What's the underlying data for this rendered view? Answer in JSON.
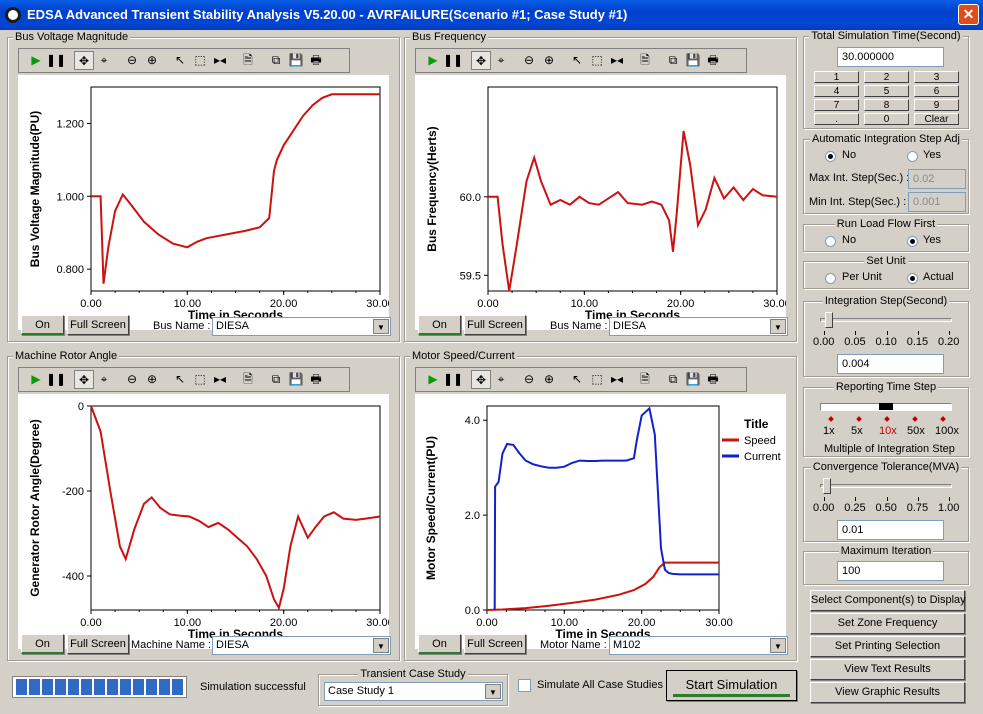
{
  "window": {
    "title": "EDSA Advanced Transient Stability Analysis V5.20.00 - AVRFAILURE(Scenario #1; Case Study #1)",
    "close": "✕"
  },
  "toolbar_icons": [
    "play-icon",
    "pause-icon",
    "move-icon",
    "zoom-fit-icon",
    "zoom-out-icon",
    "zoom-in-icon",
    "pointer-icon",
    "select-box-icon",
    "split-icon",
    "properties-icon",
    "copy-icon",
    "save-icon",
    "print-icon"
  ],
  "toolbar_glyphs": [
    "▶",
    "❚❚",
    "✥",
    "⌖",
    "⊖",
    "⊕",
    "↖",
    "⬚",
    "▸◂",
    "🗎",
    "⧉",
    "💾",
    "🖶"
  ],
  "panels": {
    "bus_voltage": {
      "title": "Bus Voltage Magnitude",
      "on": "On",
      "full_screen": "Full Screen",
      "name_label": "Bus Name :",
      "name_value": "DIESA"
    },
    "bus_frequency": {
      "title": "Bus Frequency",
      "on": "On",
      "full_screen": "Full Screen",
      "name_label": "Bus Name :",
      "name_value": "DIESA"
    },
    "rotor_angle": {
      "title": "Machine Rotor Angle",
      "on": "On",
      "full_screen": "Full Screen",
      "name_label": "Machine Name :",
      "name_value": "DIESA"
    },
    "motor_speed": {
      "title": "Motor Speed/Current",
      "on": "On",
      "full_screen": "Full Screen",
      "name_label": "Motor Name :",
      "name_value": "M102"
    }
  },
  "chart_data": [
    {
      "type": "line",
      "panel": "bus_voltage",
      "title": "",
      "xlabel": "Time in Seconds",
      "ylabel": "Bus Voltage Magnitude(PU)",
      "xlim": [
        0,
        30
      ],
      "ylim": [
        0.74,
        1.3
      ],
      "xticks": [
        "0.00",
        "10.00",
        "20.00",
        "30.00"
      ],
      "yticks": [
        "0.800",
        "1.000",
        "1.200"
      ],
      "ytick_values": [
        0.8,
        1.0,
        1.2
      ],
      "series": [
        {
          "color": "#cc1111",
          "x": [
            0,
            1,
            1.3,
            1.8,
            2.5,
            3.3,
            4.2,
            5.5,
            7,
            8.5,
            10,
            11,
            12,
            14,
            16,
            17.5,
            18.5,
            19,
            19.3,
            20,
            21,
            22,
            23,
            24,
            25,
            26,
            27,
            30
          ],
          "y": [
            1.0,
            1.0,
            0.76,
            0.86,
            0.96,
            1.005,
            0.975,
            0.93,
            0.895,
            0.87,
            0.86,
            0.875,
            0.885,
            0.895,
            0.905,
            0.915,
            0.94,
            1.07,
            1.1,
            1.14,
            1.18,
            1.22,
            1.25,
            1.27,
            1.28,
            1.28,
            1.28,
            1.28
          ]
        }
      ]
    },
    {
      "type": "line",
      "panel": "bus_frequency",
      "title": "",
      "xlabel": "Time in Seconds",
      "ylabel": "Bus Frequency(Herts)",
      "xlim": [
        0,
        30
      ],
      "ylim": [
        59.4,
        60.7
      ],
      "xticks": [
        "0.00",
        "10.00",
        "20.00",
        "30.00"
      ],
      "yticks": [
        "59.5",
        "60.0"
      ],
      "ytick_values": [
        59.5,
        60.0
      ],
      "series": [
        {
          "color": "#cc1111",
          "x": [
            0,
            1,
            1.5,
            2.2,
            3,
            4,
            4.8,
            5.5,
            6.5,
            7.5,
            8.5,
            9.5,
            10.5,
            11.5,
            12.5,
            13.5,
            14.5,
            16,
            17,
            18,
            18.8,
            19.2,
            19.6,
            20.3,
            21,
            21.8,
            22.6,
            23.5,
            24.5,
            25.5,
            26.5,
            27.5,
            28.5,
            30
          ],
          "y": [
            60.0,
            60.0,
            59.7,
            59.4,
            59.7,
            60.1,
            60.25,
            60.1,
            59.95,
            59.98,
            59.95,
            60.0,
            59.96,
            59.95,
            59.99,
            60.03,
            59.96,
            59.95,
            59.97,
            59.95,
            59.85,
            59.65,
            59.9,
            60.42,
            60.2,
            59.82,
            59.92,
            60.12,
            59.99,
            60.06,
            59.98,
            60.05,
            60.01,
            60.0
          ]
        }
      ]
    },
    {
      "type": "line",
      "panel": "rotor_angle",
      "title": "",
      "xlabel": "Time in Seconds",
      "ylabel": "Generator Rotor Angle(Degree)",
      "xlim": [
        0,
        30
      ],
      "ylim": [
        -480,
        0
      ],
      "xticks": [
        "0.00",
        "10.00",
        "20.00",
        "30.00"
      ],
      "yticks": [
        "0",
        "-200",
        "-400"
      ],
      "ytick_values": [
        0,
        -200,
        -400
      ],
      "series": [
        {
          "color": "#cc1111",
          "x": [
            0,
            1,
            2,
            3,
            3.6,
            4.5,
            5.5,
            6.3,
            7.2,
            8.2,
            9.2,
            10.2,
            11.2,
            12.2,
            13.2,
            14.2,
            15.2,
            16.2,
            17.2,
            18.2,
            19,
            19.5,
            20,
            20.7,
            21.5,
            22.5,
            23.3,
            24.2,
            25.2,
            26.2,
            27.5,
            28.5,
            30
          ],
          "y": [
            0,
            -60,
            -200,
            -330,
            -360,
            -290,
            -230,
            -215,
            -240,
            -255,
            -258,
            -260,
            -270,
            -285,
            -275,
            -290,
            -310,
            -330,
            -360,
            -400,
            -455,
            -475,
            -430,
            -330,
            -260,
            -310,
            -285,
            -260,
            -250,
            -265,
            -268,
            -265,
            -260
          ]
        }
      ]
    },
    {
      "type": "line",
      "panel": "motor_speed",
      "title": "",
      "xlabel": "Time in Seconds",
      "ylabel": "Motor Speed/Current(PU)",
      "xlim": [
        0,
        30
      ],
      "ylim": [
        0,
        4.3
      ],
      "xticks": [
        "0.00",
        "10.00",
        "20.00",
        "30.00"
      ],
      "yticks": [
        "0.0",
        "2.0",
        "4.0"
      ],
      "ytick_values": [
        0,
        2.0,
        4.0
      ],
      "legend": {
        "title": "Title",
        "placement": "top-right"
      },
      "series": [
        {
          "name": "Speed",
          "color": "#cc1111",
          "x": [
            0,
            2,
            5,
            8,
            11,
            14,
            17,
            19,
            20.5,
            21.5,
            22.3,
            23,
            25,
            30
          ],
          "y": [
            0,
            0.01,
            0.04,
            0.09,
            0.15,
            0.22,
            0.32,
            0.42,
            0.55,
            0.7,
            0.9,
            1.0,
            1.0,
            1.0
          ]
        },
        {
          "name": "Current",
          "color": "#1122cc",
          "x": [
            1,
            1.05,
            1.5,
            2,
            2.6,
            3.4,
            4.2,
            5,
            6,
            7,
            8,
            9,
            10,
            11,
            12,
            13,
            14,
            15,
            16,
            17,
            18,
            19,
            19.4,
            20,
            21,
            21.7,
            22.1,
            22.5,
            23,
            23.5,
            24,
            25,
            26,
            27,
            28,
            29,
            30
          ],
          "y": [
            0,
            2.6,
            2.7,
            3.3,
            3.5,
            3.48,
            3.3,
            3.15,
            3.07,
            3.03,
            3.0,
            3.0,
            3.02,
            3.1,
            3.15,
            3.14,
            3.14,
            3.15,
            3.15,
            3.15,
            3.15,
            3.2,
            3.6,
            4.1,
            4.25,
            3.7,
            2.5,
            1.3,
            0.85,
            0.78,
            0.76,
            0.75,
            0.75,
            0.75,
            0.75,
            0.75,
            0.75
          ]
        }
      ]
    }
  ],
  "sidebar": {
    "total_sim": {
      "title": "Total Simulation Time(Second)",
      "value": "30.000000",
      "keys": [
        "1",
        "2",
        "3",
        "4",
        "5",
        "6",
        "7",
        "8",
        "9",
        ".",
        "0",
        "Clear"
      ]
    },
    "auto_step": {
      "title": "Automatic Integration Step Adj",
      "no": "No",
      "yes": "Yes",
      "max_label": "Max Int. Step(Sec.) :",
      "max_value": "0.02",
      "min_label": "Min Int. Step(Sec.) :",
      "min_value": "0.001"
    },
    "load_flow": {
      "title": "Run Load Flow First",
      "no": "No",
      "yes": "Yes"
    },
    "set_unit": {
      "title": "Set Unit",
      "per_unit": "Per Unit",
      "actual": "Actual"
    },
    "int_step": {
      "title": "Integration Step(Second)",
      "ticks": [
        "0.00",
        "0.05",
        "0.10",
        "0.15",
        "0.20"
      ],
      "value": "0.004",
      "level": 0.02
    },
    "report_step": {
      "title": "Reporting Time Step",
      "ticks": [
        "1x",
        "5x",
        "10x",
        "50x",
        "100x"
      ],
      "caption": "Multiple of Integration Step",
      "selected": "10x"
    },
    "convergence": {
      "title": "Convergence Tolerance(MVA)",
      "ticks": [
        "0.00",
        "0.25",
        "0.50",
        "0.75",
        "1.00"
      ],
      "value": "0.01",
      "level": 0.01
    },
    "max_iter": {
      "title": "Maximum Iteration",
      "value": "100"
    },
    "buttons": {
      "select": "Select Component(s) to Display",
      "zone": "Set Zone Frequency",
      "printing": "Set Printing Selection",
      "text": "View Text Results",
      "graphic": "View Graphic Results"
    }
  },
  "bottom": {
    "progress": 1.0,
    "status": "Simulation successful",
    "case_title": "Transient Case Study",
    "case_value": "Case Study 1",
    "simulate_all": "Simulate All Case Studies",
    "start": "Start Simulation"
  }
}
